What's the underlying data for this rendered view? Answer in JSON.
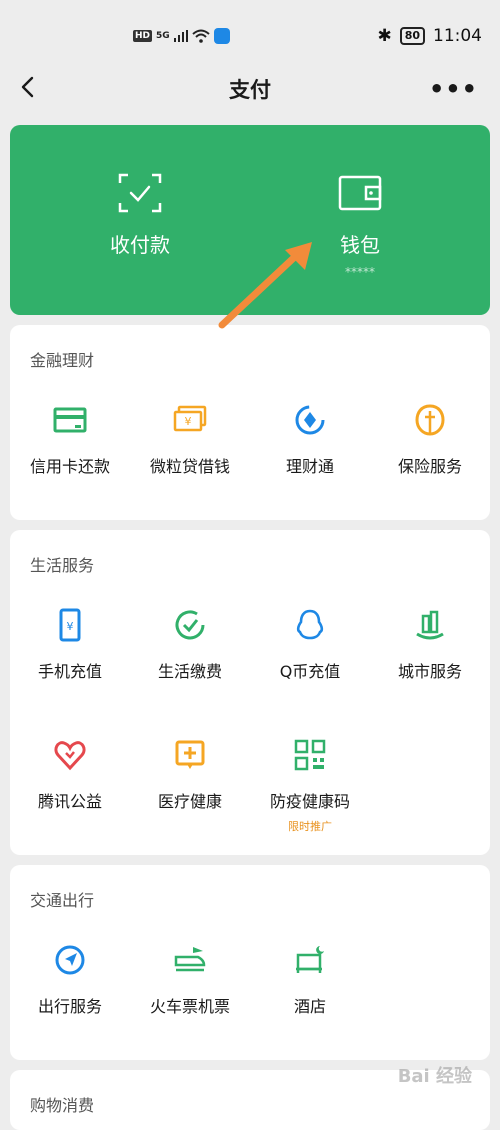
{
  "status": {
    "hd": "HD",
    "net": "5G",
    "battery": "80",
    "time": "11:04"
  },
  "nav": {
    "title": "支付",
    "more": "•••"
  },
  "hero": {
    "collect": {
      "label": "收付款"
    },
    "wallet": {
      "label": "钱包",
      "sub": "*****"
    }
  },
  "sections": {
    "finance": {
      "title": "金融理财",
      "items": [
        {
          "label": "信用卡还款",
          "icon": "credit-card-icon"
        },
        {
          "label": "微粒贷借钱",
          "icon": "loan-icon"
        },
        {
          "label": "理财通",
          "icon": "wealth-icon"
        },
        {
          "label": "保险服务",
          "icon": "insurance-icon"
        }
      ]
    },
    "life": {
      "title": "生活服务",
      "items": [
        {
          "label": "手机充值",
          "icon": "phone-topup-icon"
        },
        {
          "label": "生活缴费",
          "icon": "bill-pay-icon"
        },
        {
          "label": "Q币充值",
          "icon": "qq-coin-icon"
        },
        {
          "label": "城市服务",
          "icon": "city-service-icon"
        },
        {
          "label": "腾讯公益",
          "icon": "charity-icon"
        },
        {
          "label": "医疗健康",
          "icon": "medical-icon"
        },
        {
          "label": "防疫健康码",
          "icon": "health-code-icon",
          "sub": "限时推广"
        }
      ]
    },
    "transport": {
      "title": "交通出行",
      "items": [
        {
          "label": "出行服务",
          "icon": "travel-icon"
        },
        {
          "label": "火车票机票",
          "icon": "train-plane-icon"
        },
        {
          "label": "酒店",
          "icon": "hotel-icon"
        }
      ]
    },
    "shopping": {
      "title": "购物消费"
    }
  },
  "colors": {
    "brand": "#31b06a",
    "orange": "#f5a623",
    "blue": "#1e88e5",
    "red": "#e5484d"
  },
  "watermark": "Bai 经验"
}
